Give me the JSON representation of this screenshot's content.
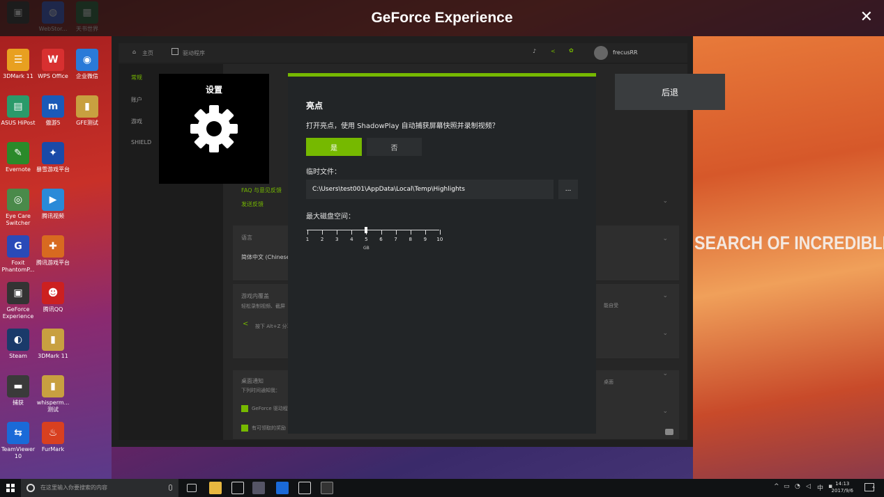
{
  "window": {
    "title": "GeForce Experience",
    "close_glyph": "✕"
  },
  "wallpaper": {
    "tagline": "SEARCH OF INCREDIBLE"
  },
  "desktop_icons": [
    {
      "label": "",
      "color": "#333333",
      "glyph": "▣"
    },
    {
      "label": "WebStor...",
      "color": "#3a5ad8",
      "glyph": "◍"
    },
    {
      "label": "天书世界",
      "color": "#2a6a3a",
      "glyph": "▦"
    },
    {
      "label": "3DMark 11",
      "color": "#e8a020",
      "glyph": "☰"
    },
    {
      "label": "WPS Office",
      "color": "#d83030",
      "glyph": "W"
    },
    {
      "label": "企业微信",
      "color": "#2a7ad8",
      "glyph": "◉"
    },
    {
      "label": "ASUS HiPost",
      "color": "#2a9a6a",
      "glyph": "▤"
    },
    {
      "label": "傲游5",
      "color": "#1a5ab8",
      "glyph": "m"
    },
    {
      "label": "GFE测试",
      "color": "#c8a040",
      "glyph": "▮"
    },
    {
      "label": "Evernote",
      "color": "#2a8a2a",
      "glyph": "✎"
    },
    {
      "label": "暴雪游戏平台",
      "color": "#1a4aa8",
      "glyph": "✦"
    },
    {
      "label": "Eye Care Switcher",
      "color": "#4a8a4a",
      "glyph": "◎"
    },
    {
      "label": "腾讯视频",
      "color": "#2a8ad8",
      "glyph": "▶"
    },
    {
      "label": "Foxit PhantomP...",
      "color": "#2a4ab8",
      "glyph": "G"
    },
    {
      "label": "腾讯游戏平台",
      "color": "#d86a20",
      "glyph": "✚"
    },
    {
      "label": "GeForce Experience",
      "color": "#333333",
      "glyph": "▣"
    },
    {
      "label": "腾讯QQ",
      "color": "#cc2020",
      "glyph": "☻"
    },
    {
      "label": "Steam",
      "color": "#1a3a6a",
      "glyph": "◐"
    },
    {
      "label": "3DMark 11",
      "color": "#c8a040",
      "glyph": "▮"
    },
    {
      "label": "捕获",
      "color": "#3a3a3a",
      "glyph": "▬"
    },
    {
      "label": "whisperm... 测试",
      "color": "#c8a040",
      "glyph": "▮"
    },
    {
      "label": "TeamViewer 10",
      "color": "#1a6ad8",
      "glyph": "⇆"
    },
    {
      "label": "FurMark",
      "color": "#d84020",
      "glyph": "♨"
    }
  ],
  "app": {
    "nav_home": "主页",
    "nav_drivers": "驱动程序",
    "username": "frecusRR",
    "sidebar": [
      "常规",
      "账户",
      "游戏",
      "SHIELD"
    ],
    "faq_text": "FAQ 与意见反馈",
    "send_feedback": "发送反馈",
    "language_title": "语言",
    "language_value": "简体中文 (Chinese",
    "overlay_title": "游戏内覆盖",
    "overlay_desc": "轻松录制视频、截屏",
    "overlay_hint": "按下 Alt+Z 分享",
    "desktop_notify_title": "桌面通知",
    "desktop_notify_desc": "下列时间通知我：",
    "notify_option_1": "GeForce 驱动程序",
    "notify_option_2": "有可领取的奖励",
    "tail_text_1": "能自受",
    "tail_text_2": "桌面"
  },
  "settings_tile": {
    "label": "设置"
  },
  "dialog": {
    "heading": "亮点",
    "question": "打开亮点，使用 ShadowPlay 自动捕获屏幕快照并录制视频？",
    "yes_label": "是",
    "no_label": "否",
    "temp_label": "临时文件：",
    "temp_path": "C:\\Users\\test001\\AppData\\Local\\Temp\\Highlights",
    "browse_label": "...",
    "disk_label": "最大磁盘空间：",
    "disk_scale": [
      1,
      2,
      3,
      4,
      5,
      6,
      7,
      8,
      9,
      10
    ],
    "disk_value": 5,
    "disk_unit": "GB"
  },
  "back_button": {
    "label": "后退"
  },
  "taskbar": {
    "search_placeholder": "在这里输入你要搜索的内容",
    "time": "14:13",
    "date": "2017/9/6",
    "ime": "中",
    "notification_count": "4"
  },
  "colors": {
    "accent": "#76b900",
    "dialog_bg": "#222527",
    "tile_bg": "#000000"
  }
}
